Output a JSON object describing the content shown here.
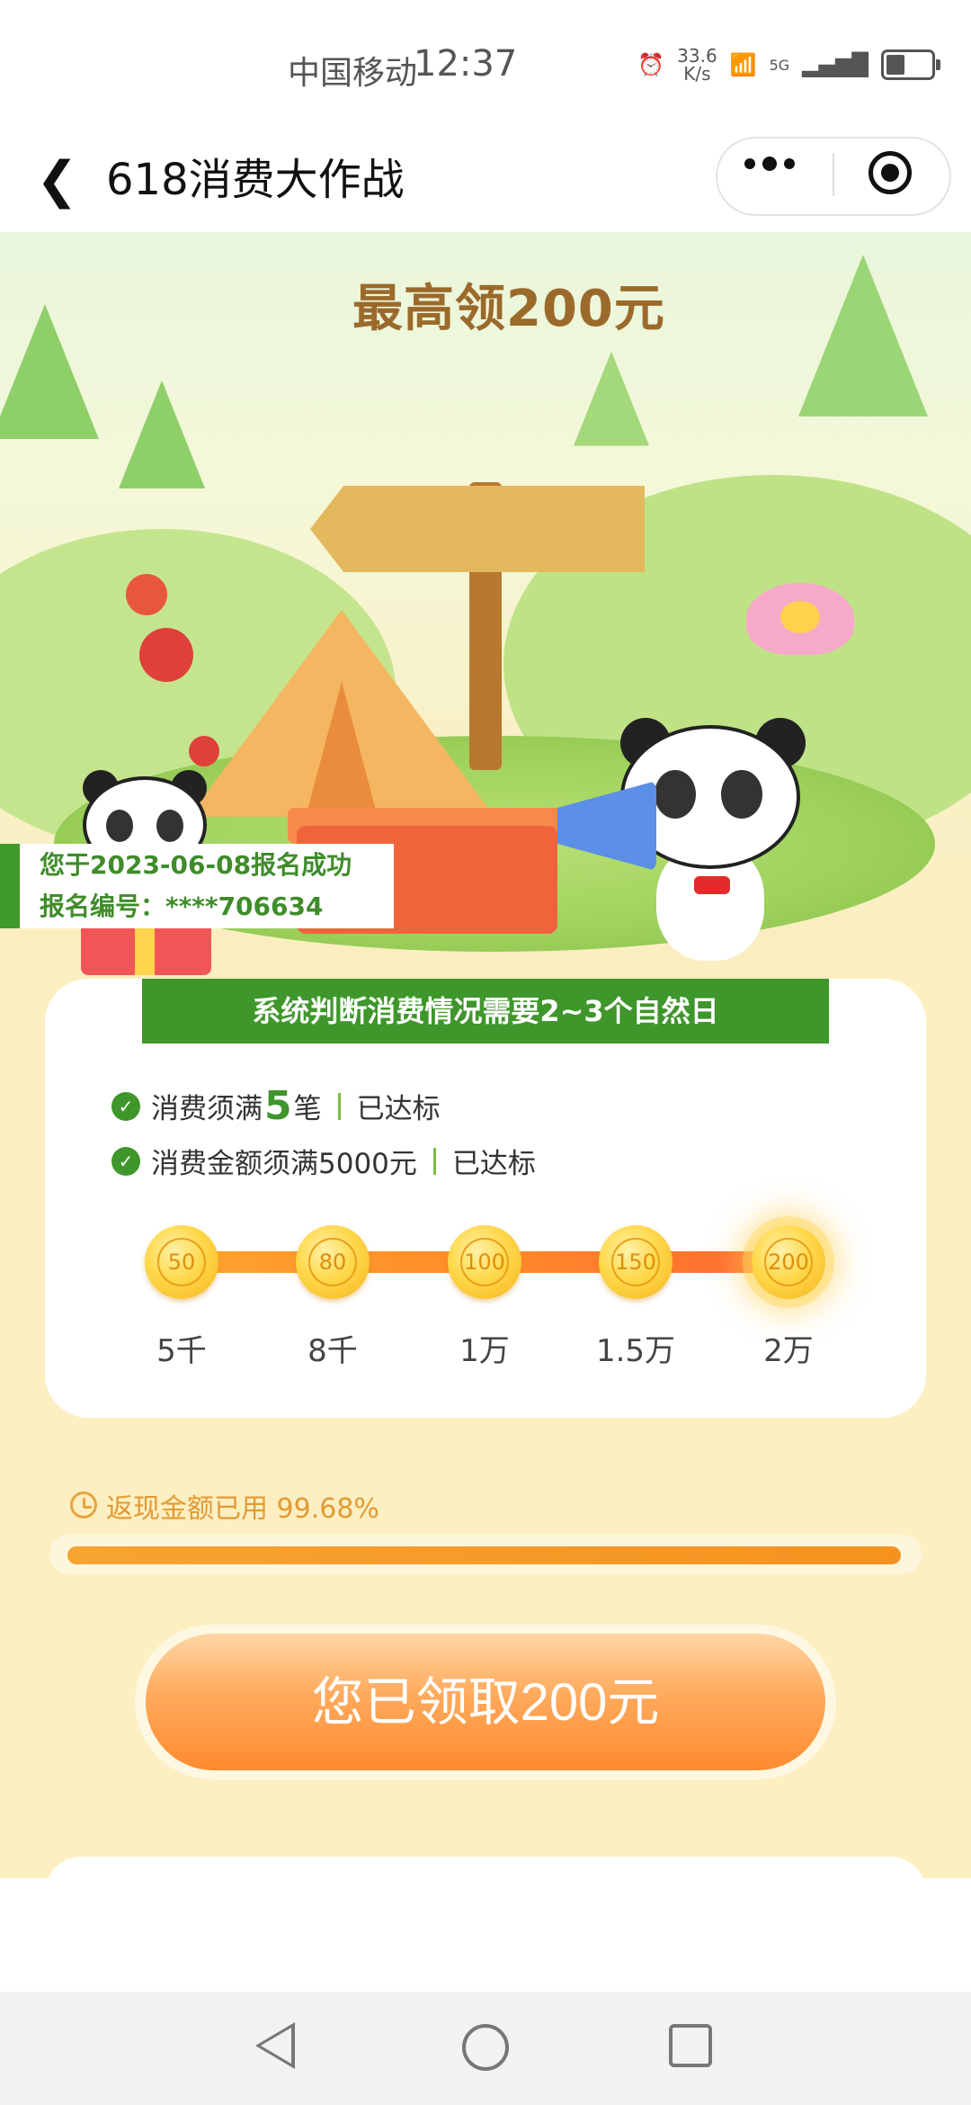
{
  "status_bar": {
    "carrier": "中国移动",
    "time": "12:37",
    "net_speed_value": "33.6",
    "net_speed_unit": "K/s",
    "network": "5G"
  },
  "nav": {
    "title": "618消费大作战"
  },
  "banner": {
    "sign_text": "最高领200元"
  },
  "registration": {
    "line1": "您于2023-06-08报名成功",
    "line2": "报名编号：****706634"
  },
  "card": {
    "title": "系统判断消费情况需要2~3个自然日",
    "conditions": [
      {
        "prefix": "消费须满",
        "highlight": "5",
        "suffix": "笔",
        "status": "已达标"
      },
      {
        "prefix": "消费金额须满5000元",
        "highlight": "",
        "suffix": "",
        "status": "已达标"
      }
    ],
    "tiers": [
      {
        "reward": "50",
        "threshold": "5千"
      },
      {
        "reward": "80",
        "threshold": "8千"
      },
      {
        "reward": "100",
        "threshold": "1万"
      },
      {
        "reward": "150",
        "threshold": "1.5万"
      },
      {
        "reward": "200",
        "threshold": "2万"
      }
    ],
    "achieved_tier": "200"
  },
  "cashback": {
    "used_label": "返现金额已用 99.68%",
    "used_percent": 99.68
  },
  "cta": {
    "label": "您已领取200元"
  },
  "colors": {
    "brand_green": "#3f962b",
    "progress_orange": "#f5921f",
    "cta_orange": "#ff8a2e",
    "page_bg": "#fdefc1"
  }
}
